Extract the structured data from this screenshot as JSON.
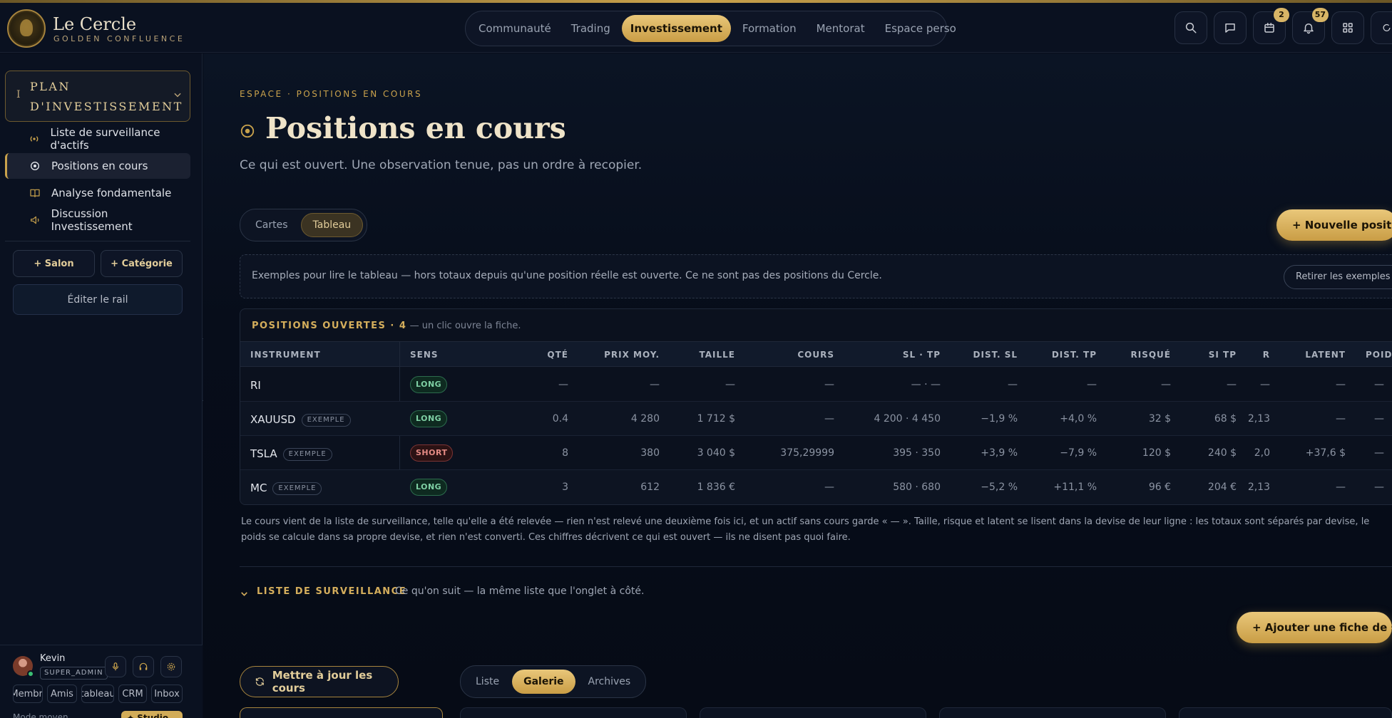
{
  "brand": {
    "name": "Le Cercle",
    "subtitle": "GOLDEN CONFLUENCE"
  },
  "nav": {
    "tabs": [
      {
        "label": "Communauté"
      },
      {
        "label": "Trading"
      },
      {
        "label": "Investissement",
        "active": true
      },
      {
        "label": "Formation"
      },
      {
        "label": "Mentorat"
      },
      {
        "label": "Espace perso"
      }
    ]
  },
  "toolbar": {
    "icons": [
      "search-icon",
      "chat-icon",
      "calendar-icon",
      "bell-icon",
      "grid-icon",
      "refresh-icon"
    ],
    "calendar_badge": "2",
    "bell_badge": "57"
  },
  "sidebar": {
    "plan_marker": "I",
    "plan_title": "PLAN D'INVESTISSEMENT",
    "items": [
      {
        "label": "Liste de surveillance d'actifs",
        "icon": "radio-waves-icon"
      },
      {
        "label": "Positions en cours",
        "icon": "target-icon",
        "active": true
      },
      {
        "label": "Analyse fondamentale",
        "icon": "book-icon"
      },
      {
        "label": "Discussion Investissement",
        "icon": "speaker-icon"
      }
    ],
    "add_salon": "+ Salon",
    "add_category": "+ Catégorie",
    "edit_rail": "Éditer le rail"
  },
  "user": {
    "name": "Kevin",
    "role": "SUPER_ADMIN",
    "chips": [
      "Membre",
      "Amis",
      "tableau",
      "CRM",
      "Inbox"
    ],
    "bottom_text": "Mode moyen",
    "bottom_button": "✦ Studio"
  },
  "page": {
    "eyebrow": "ESPACE · POSITIONS EN COURS",
    "title": "Positions en cours",
    "subtitle": "Ce qui est ouvert. Une observation tenue, pas un ordre à recopier.",
    "view_toggle": [
      {
        "label": "Cartes"
      },
      {
        "label": "Tableau",
        "active": true
      }
    ],
    "new_position": "+ Nouvelle position",
    "notice": "Exemples pour lire le tableau — hors totaux depuis qu'une position réelle est ouverte. Ce ne sont pas des positions du Cercle.",
    "notice_button": "Retirer les exemples"
  },
  "table": {
    "heading": "POSITIONS OUVERTES · 4",
    "heading_hint": " — un clic ouvre la fiche.",
    "columns": [
      "INSTRUMENT",
      "SENS",
      "QTÉ",
      "PRIX MOY.",
      "TAILLE",
      "COURS",
      "SL · TP",
      "DIST. SL",
      "DIST. TP",
      "RISQUÉ",
      "SI TP",
      "R",
      "LATENT",
      "POIDS"
    ],
    "rows": [
      {
        "instrument": "RI",
        "tag": "",
        "sens": "LONG",
        "qte": "—",
        "prix": "—",
        "taille": "—",
        "cours": "—",
        "sltp": "— · —",
        "dist_sl": "—",
        "dist_tp": "—",
        "risque": "—",
        "si_tp": "—",
        "r": "—",
        "latent": "—",
        "poids": "—"
      },
      {
        "instrument": "XAUUSD",
        "tag": "EXEMPLE",
        "sens": "LONG",
        "qte": "0.4",
        "prix": "4 280",
        "taille": "1 712 $",
        "cours": "—",
        "sltp": "4 200 · 4 450",
        "dist_sl": "−1,9 %",
        "dist_tp": "+4,0 %",
        "risque": "32 $",
        "si_tp": "68 $",
        "r": "2,13",
        "latent": "—",
        "poids": "—"
      },
      {
        "instrument": "TSLA",
        "tag": "EXEMPLE",
        "sens": "SHORT",
        "qte": "8",
        "prix": "380",
        "taille": "3 040 $",
        "cours": "375,29999",
        "sltp": "395 · 350",
        "dist_sl": "+3,9 %",
        "dist_tp": "−7,9 %",
        "risque": "120 $",
        "si_tp": "240 $",
        "r": "2,0",
        "latent": "+37,6 $",
        "poids": "—"
      },
      {
        "instrument": "MC",
        "tag": "EXEMPLE",
        "sens": "LONG",
        "qte": "3",
        "prix": "612",
        "taille": "1 836 €",
        "cours": "—",
        "sltp": "580 · 680",
        "dist_sl": "−5,2 %",
        "dist_tp": "+11,1 %",
        "risque": "96 €",
        "si_tp": "204 €",
        "r": "2,13",
        "latent": "—",
        "poids": "—"
      }
    ],
    "footnote": "Le cours vient de la liste de surveillance, telle qu'elle a été relevée — rien n'est relevé une deuxième fois ici, et un actif sans cours garde « — ». Taille, risque et latent se lisent dans la devise de leur ligne : les totaux sont séparés par devise, le poids se calcule dans sa propre devise, et rien n'est converti. Ces chiffres décrivent ce qui est ouvert — ils ne disent pas quoi faire."
  },
  "watchlist": {
    "title": "LISTE DE SURVEILLANCE",
    "subtitle": "Ce qu'on suit — la même liste que l'onglet à côté.",
    "add_button": "+ Ajouter une fiche de suivi",
    "update_button": "Mettre à jour les cours",
    "views": [
      {
        "label": "Liste"
      },
      {
        "label": "Galerie",
        "active": true
      },
      {
        "label": "Archives"
      }
    ]
  }
}
